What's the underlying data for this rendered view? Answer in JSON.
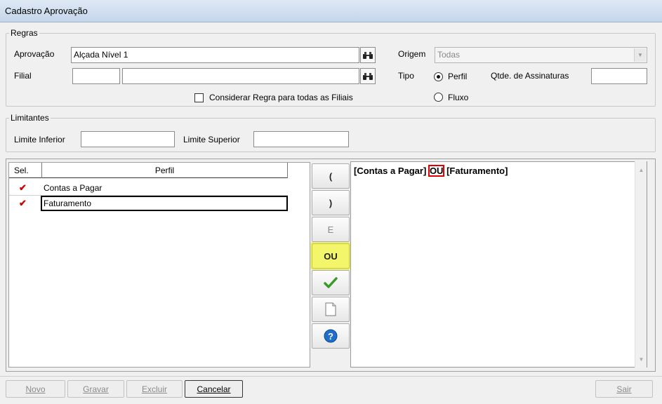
{
  "window": {
    "title": "Cadastro Aprovação"
  },
  "regras": {
    "legend": "Regras",
    "aprovacao": {
      "label": "Aprovação",
      "value": "Alçada Nível 1"
    },
    "filial": {
      "label": "Filial",
      "code_value": "",
      "name_value": ""
    },
    "checkbox_label": "Considerar Regra para todas as Filiais",
    "origem": {
      "label": "Origem",
      "value": "Todas"
    },
    "tipo": {
      "label": "Tipo",
      "options": [
        "Perfil",
        "Fluxo"
      ],
      "selected": "Perfil"
    },
    "assinaturas": {
      "label": "Qtde. de Assinaturas",
      "value": ""
    }
  },
  "limitantes": {
    "legend": "Limitantes",
    "inferior": {
      "label": "Limite Inferior",
      "value": ""
    },
    "superior": {
      "label": "Limite Superior",
      "value": ""
    }
  },
  "grid": {
    "columns": [
      "Sel.",
      "Perfil"
    ],
    "rows": [
      {
        "selected": true,
        "perfil": "Contas a Pagar"
      },
      {
        "selected": true,
        "perfil": "Faturamento"
      }
    ]
  },
  "operators": {
    "open_paren": "(",
    "close_paren": ")",
    "and": "E",
    "or": "OU",
    "confirm_icon": "check-icon",
    "new_icon": "document-icon",
    "help_icon": "help-icon"
  },
  "expression": {
    "part1": "[Contas a Pagar]",
    "op": "OU",
    "part2": "[Faturamento]"
  },
  "footer": {
    "novo": "Novo",
    "gravar": "Gravar",
    "excluir": "Excluir",
    "cancelar": "Cancelar",
    "sair": "Sair"
  },
  "colors": {
    "highlight": "#f3f56a",
    "check": "#d10000",
    "title_bg": "#c5d6ea"
  }
}
